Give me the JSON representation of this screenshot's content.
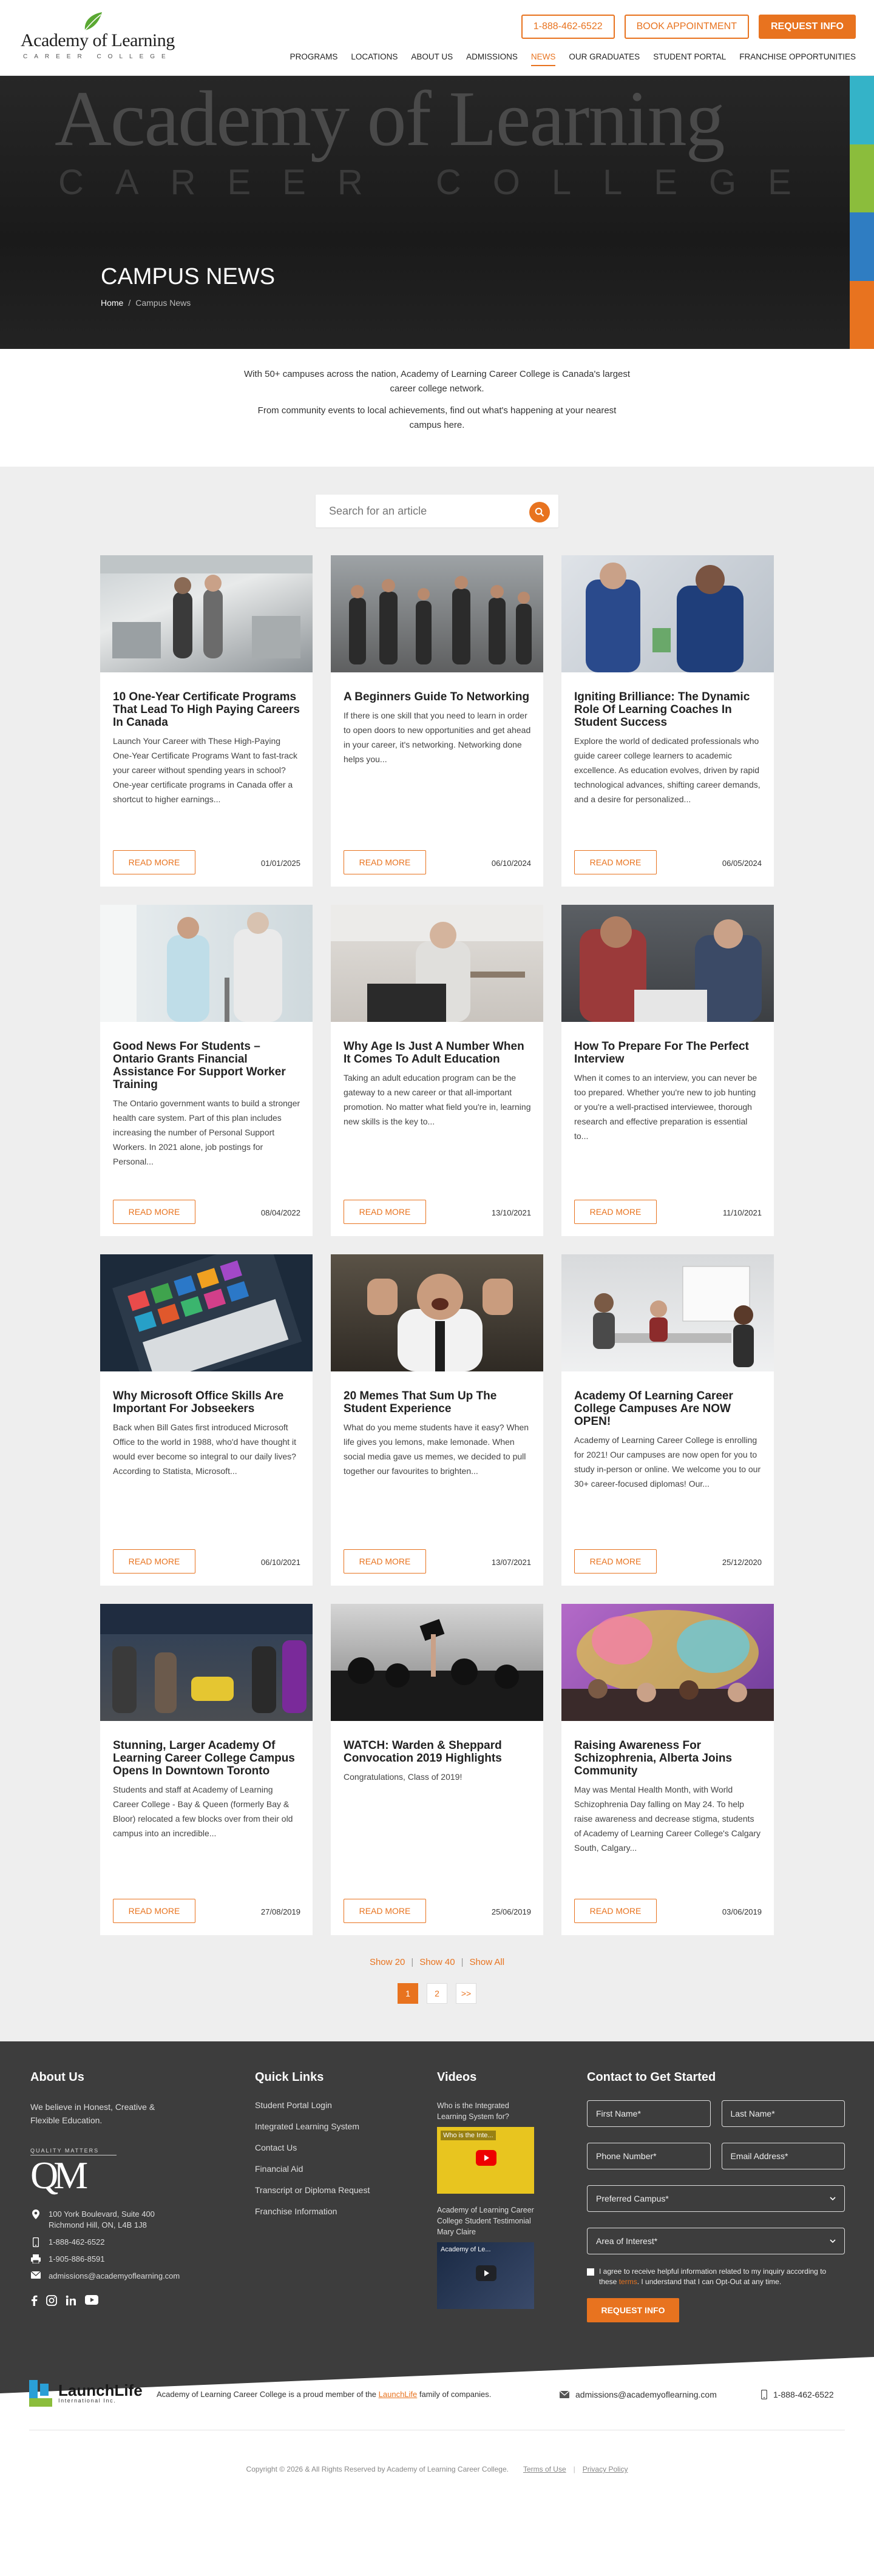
{
  "header": {
    "logo_name": "Academy of Learning",
    "logo_sub": "CAREER COLLEGE",
    "phone": "1-888-462-6522",
    "book": "BOOK APPOINTMENT",
    "request": "REQUEST INFO",
    "nav": [
      "PROGRAMS",
      "LOCATIONS",
      "ABOUT US",
      "ADMISSIONS",
      "NEWS",
      "OUR GRADUATES",
      "STUDENT PORTAL",
      "FRANCHISE OPPORTUNITIES"
    ],
    "active_nav": "NEWS"
  },
  "hero": {
    "bg_text": "Academy of Learning",
    "bg_sub": "CAREER COLLEGE",
    "title": "CAMPUS NEWS",
    "crumb_home": "Home",
    "crumb_sep": "/",
    "crumb_current": "Campus News",
    "stripe_colors": [
      "#34b3c8",
      "#8bbd3c",
      "#2f7dc2",
      "#e8731f"
    ]
  },
  "intro": {
    "p1": "With 50+ campuses across the nation, Academy of Learning Career College is Canada's largest career college network.",
    "p2": "From community events to local achievements, find out what's happening at your nearest campus here."
  },
  "search": {
    "placeholder": "Search for an article"
  },
  "colors": {
    "accent": "#e8731f",
    "footer_bg": "#3d3d3d",
    "listing_bg": "#eeeeee"
  },
  "articles": [
    {
      "title": "10 One-Year Certificate Programs That Lead To High Paying Careers In Canada",
      "excerpt": "Launch Your Career with These High-Paying One-Year Certificate Programs Want to fast-track your career without spending years in school? One-year certificate programs in Canada offer a shortcut to higher earnings...",
      "date": "01/01/2025",
      "read_more": "READ MORE"
    },
    {
      "title": "A Beginners Guide To Networking",
      "excerpt": "If there is one skill that you need to learn in order to open doors to new opportunities and get ahead in your career, it's networking. Networking done helps you...",
      "date": "06/10/2024",
      "read_more": "READ MORE"
    },
    {
      "title": "Igniting Brilliance: The Dynamic Role Of Learning Coaches In Student Success",
      "excerpt": "Explore the world of dedicated professionals who guide career college learners to academic excellence. As education evolves, driven by rapid technological advances, shifting career demands, and a desire for personalized...",
      "date": "06/05/2024",
      "read_more": "READ MORE"
    },
    {
      "title": "Good News For Students – Ontario Grants Financial Assistance For Support Worker Training",
      "excerpt": "The Ontario government wants to build a stronger health care system. Part of this plan includes increasing the number of Personal Support Workers. In 2021 alone, job postings for Personal...",
      "date": "08/04/2022",
      "read_more": "READ MORE"
    },
    {
      "title": "Why Age Is Just A Number When It Comes To Adult Education",
      "excerpt": "Taking an adult education program can be the gateway to a new career or that all-important promotion. No matter what field you're in, learning new skills is the key to...",
      "date": "13/10/2021",
      "read_more": "READ MORE"
    },
    {
      "title": "How To Prepare For The Perfect Interview",
      "excerpt": "When it comes to an interview, you can never be too prepared. Whether you're new to job hunting or you're a well-practised interviewee, thorough research and effective preparation is essential to...",
      "date": "11/10/2021",
      "read_more": "READ MORE"
    },
    {
      "title": "Why Microsoft Office Skills Are Important For Jobseekers",
      "excerpt": "Back when Bill Gates first introduced Microsoft Office to the world in 1988, who'd have thought it would ever become so integral to our daily lives? According to Statista, Microsoft...",
      "date": "06/10/2021",
      "read_more": "READ MORE"
    },
    {
      "title": "20 Memes That Sum Up The Student Experience",
      "excerpt": "What do you meme students have it easy? When life gives you lemons, make lemonade. When social media gave us memes, we decided to pull together our favourites to brighten...",
      "date": "13/07/2021",
      "read_more": "READ MORE"
    },
    {
      "title": "Academy Of Learning Career College Campuses Are NOW OPEN!",
      "excerpt": "Academy of Learning Career College is enrolling for 2021! Our campuses are now open for you to study in-person or online. We welcome you to our 30+ career-focused diplomas! Our...",
      "date": "25/12/2020",
      "read_more": "READ MORE"
    },
    {
      "title": "Stunning, Larger Academy Of Learning Career College Campus Opens In Downtown Toronto",
      "excerpt": " Students and staff at Academy of Learning Career College - Bay & Queen (formerly Bay & Bloor) relocated a few blocks over from their old campus into an incredible...",
      "date": "27/08/2019",
      "read_more": "READ MORE"
    },
    {
      "title": "WATCH: Warden & Sheppard Convocation 2019 Highlights",
      "excerpt": "Congratulations, Class of 2019!",
      "date": "25/06/2019",
      "read_more": "READ MORE"
    },
    {
      "title": "Raising Awareness For Schizophrenia, Alberta Joins Community",
      "excerpt": "May was Mental Health Month, with World Schizophrenia Day falling on May 24. To help raise awareness and decrease stigma, students of Academy of Learning Career College's Calgary South, Calgary...",
      "date": "03/06/2019",
      "read_more": "READ MORE"
    }
  ],
  "listing": {
    "show20": "Show 20",
    "sep": "|",
    "show40": "Show 40",
    "showall": "Show All",
    "pages": [
      "1",
      "2",
      ">>"
    ],
    "current_page": "1"
  },
  "footer": {
    "about_title": "About Us",
    "about_text": "We believe in Honest, Creative & Flexible Education.",
    "qm_title": "QUALITY MATTERS",
    "qm_mark": "QM",
    "address": "100 York Boulevard, Suite 400 Richmond Hill, ON, L4B 1J8",
    "phone": "1-888-462-6522",
    "fax": "1-905-886-8591",
    "email": "admissions@academyoflearning.com",
    "quick_title": "Quick Links",
    "quick_links": [
      "Student Portal Login",
      "Integrated Learning System",
      "Contact Us",
      "Financial Aid",
      "Transcript or Diploma Request",
      "Franchise Information"
    ],
    "videos_title": "Videos",
    "video1_label": "Who is the Integrated Learning System for?",
    "video1_caption": "Who is the Inte...",
    "video2_label": "Academy of Learning Career College Student Testimonial Mary Claire",
    "video2_caption": "Academy of Le...",
    "contact_title": "Contact to Get Started",
    "first_name": "First Name*",
    "last_name": "Last Name*",
    "phone_field": "Phone Number*",
    "email_field": "Email Address*",
    "campus": "Preferred Campus*",
    "interest": "Area of Interest*",
    "agree_a": "I agree to receive helpful information related to my inquiry according to these",
    "agree_link": "terms",
    "agree_b": ". I understand that I can Opt-Out at any time.",
    "submit": "REQUEST INFO"
  },
  "bottom": {
    "ll_name": "LaunchLife",
    "ll_sub": "International Inc.",
    "member_a": "Academy of Learning Career College is a proud member of the",
    "member_link": "LaunchLife",
    "member_b": "family of companies.",
    "email": "admissions@academyoflearning.com",
    "phone": "1-888-462-6522",
    "copyright": "Copyright © 2026 & All Rights Reserved by Academy of Learning Career College.",
    "terms": "Terms of Use",
    "sep": "|",
    "privacy": "Privacy Policy"
  }
}
